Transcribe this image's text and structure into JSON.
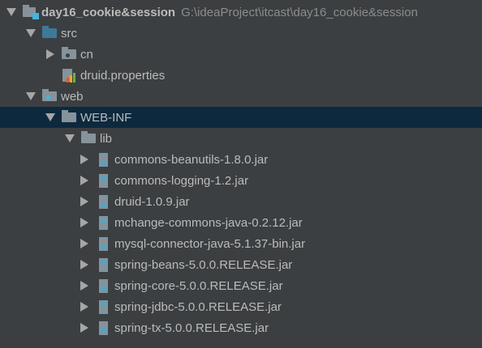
{
  "tree": [
    {
      "label": "day16_cookie&session",
      "path": "G:\\ideaProject\\itcast\\day16_cookie&session",
      "level": 0,
      "expanded": true,
      "icon": "project-folder-icon"
    },
    {
      "label": "src",
      "level": 1,
      "expanded": true,
      "icon": "source-folder-icon"
    },
    {
      "label": "cn",
      "level": 2,
      "expanded": false,
      "icon": "package-icon"
    },
    {
      "label": "druid.properties",
      "level": 2,
      "icon": "properties-file-icon"
    },
    {
      "label": "web",
      "level": 1,
      "expanded": true,
      "icon": "web-folder-icon"
    },
    {
      "label": "WEB-INF",
      "level": 2,
      "expanded": true,
      "icon": "folder-icon",
      "selected": true
    },
    {
      "label": "lib",
      "level": 3,
      "expanded": true,
      "icon": "folder-icon"
    },
    {
      "label": "commons-beanutils-1.8.0.jar",
      "level": 4,
      "expanded": false,
      "icon": "jar-icon"
    },
    {
      "label": "commons-logging-1.2.jar",
      "level": 4,
      "expanded": false,
      "icon": "jar-icon"
    },
    {
      "label": "druid-1.0.9.jar",
      "level": 4,
      "expanded": false,
      "icon": "jar-icon"
    },
    {
      "label": "mchange-commons-java-0.2.12.jar",
      "level": 4,
      "expanded": false,
      "icon": "jar-icon"
    },
    {
      "label": "mysql-connector-java-5.1.37-bin.jar",
      "level": 4,
      "expanded": false,
      "icon": "jar-icon"
    },
    {
      "label": "spring-beans-5.0.0.RELEASE.jar",
      "level": 4,
      "expanded": false,
      "icon": "jar-icon"
    },
    {
      "label": "spring-core-5.0.0.RELEASE.jar",
      "level": 4,
      "expanded": false,
      "icon": "jar-icon"
    },
    {
      "label": "spring-jdbc-5.0.0.RELEASE.jar",
      "level": 4,
      "expanded": false,
      "icon": "jar-icon"
    },
    {
      "label": "spring-tx-5.0.0.RELEASE.jar",
      "level": 4,
      "expanded": false,
      "icon": "jar-icon"
    }
  ],
  "colors": {
    "background": "#3c3f41",
    "selection": "#0d293e",
    "text": "#bbbbbb",
    "accent": "#40b6e0"
  }
}
